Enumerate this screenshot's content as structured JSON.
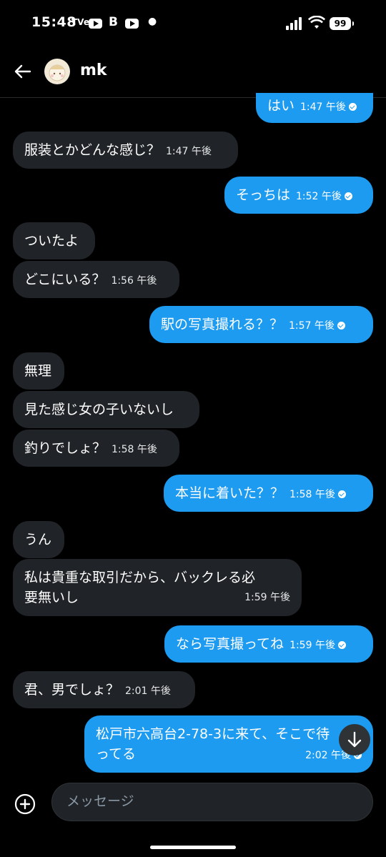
{
  "status_bar": {
    "time": "15:48",
    "app1": "TVer",
    "app3": "B",
    "battery": "99"
  },
  "header": {
    "title": "mk"
  },
  "messages": [
    {
      "dir": "out",
      "text": "はい",
      "time": "1:47 午後"
    },
    {
      "dir": "in",
      "text": "服装とかどんな感じ？",
      "time": "1:47 午後"
    },
    {
      "dir": "out",
      "text": "そっちは",
      "time": "1:52 午後"
    },
    {
      "dir": "in",
      "text": "ついたよ",
      "time": ""
    },
    {
      "dir": "in",
      "text": "どこにいる？",
      "time": "1:56 午後"
    },
    {
      "dir": "out",
      "text": "駅の写真撮れる？？",
      "time": "1:57 午後"
    },
    {
      "dir": "in",
      "text": "無理",
      "time": ""
    },
    {
      "dir": "in",
      "text": "見た感じ女の子いないし",
      "time": ""
    },
    {
      "dir": "in",
      "text": "釣りでしょ？",
      "time": "1:58 午後"
    },
    {
      "dir": "out",
      "text": "本当に着いた？？",
      "time": "1:58 午後"
    },
    {
      "dir": "in",
      "text": "うん",
      "time": ""
    },
    {
      "dir": "in",
      "text_line1": "私は貴重な取引だから、バックレる必",
      "text_line2": "要無いし",
      "time": "1:59 午後"
    },
    {
      "dir": "out",
      "text": "なら写真撮ってね",
      "time": "1:59 午後"
    },
    {
      "dir": "in",
      "text": "君、男でしょ？",
      "time": "2:01 午後"
    },
    {
      "dir": "out",
      "text_line1": "松戸市六高台2-78-3に来て、そこで待",
      "text_line2": "ってる",
      "time": "2:02 午後"
    }
  ],
  "composer": {
    "placeholder": "メッセージ"
  },
  "colors": {
    "outgoing": "#1d9bf0",
    "incoming": "#202327",
    "background": "#000000"
  },
  "icons": {
    "back": "arrow-left-icon",
    "add": "plus-circle-icon",
    "scroll": "arrow-down-icon"
  }
}
